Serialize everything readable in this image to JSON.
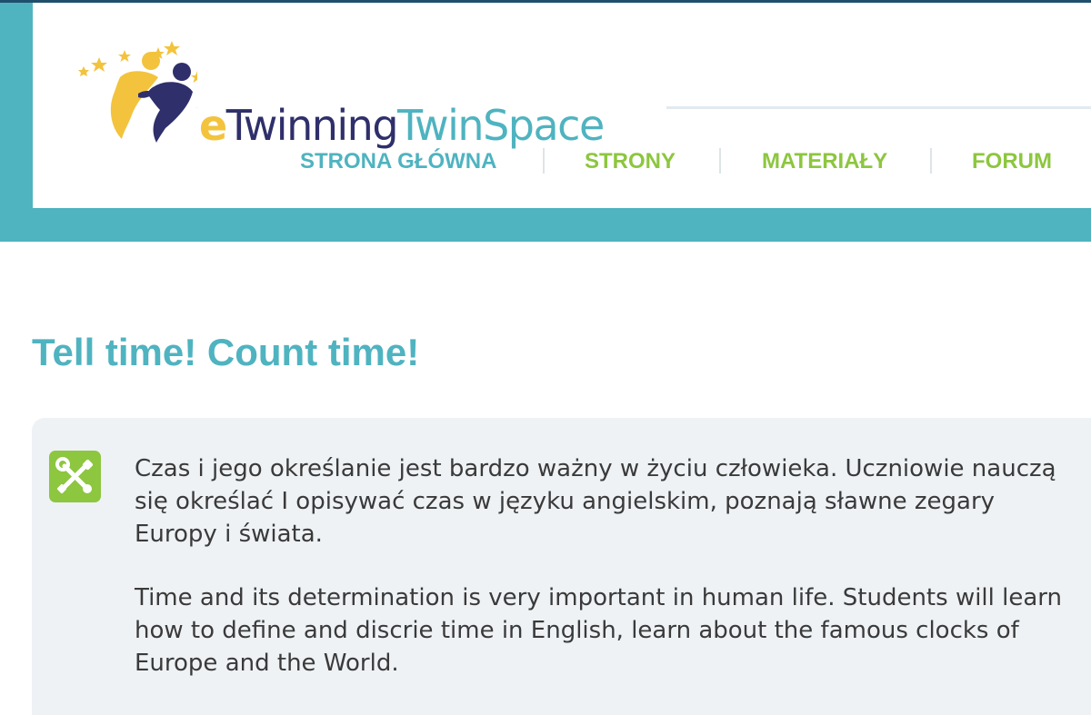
{
  "brand": {
    "logo_e": "e",
    "logo_twinning": "Twinning",
    "logo_twinspace": "TwinSpace"
  },
  "nav": {
    "items": [
      {
        "label": "STRONA GŁÓWNA",
        "color": "#4fb3c0"
      },
      {
        "label": "STRONY",
        "color": "#8dc63f"
      },
      {
        "label": "MATERIAŁY",
        "color": "#8dc63f"
      },
      {
        "label": "FORUM",
        "color": "#8dc63f"
      }
    ]
  },
  "page": {
    "title": "Tell time! Count time!"
  },
  "description": {
    "icon": "tools-icon",
    "paragraph_pl": "Czas i jego określanie jest bardzo ważny w życiu człowieka. Uczniowie nauczą się określać I opisywać czas w języku angielskim, poznają sławne zegary Europy i świata.",
    "paragraph_en": "Time and its determination is very important in human life. Students will learn how to define and discrie time in English, learn about the famous clocks of Europe and the World."
  },
  "colors": {
    "teal": "#4fb3c0",
    "green": "#8dc63f",
    "navy": "#2f2f6b",
    "yellow": "#f3c33d",
    "box_bg": "#eef2f5"
  }
}
